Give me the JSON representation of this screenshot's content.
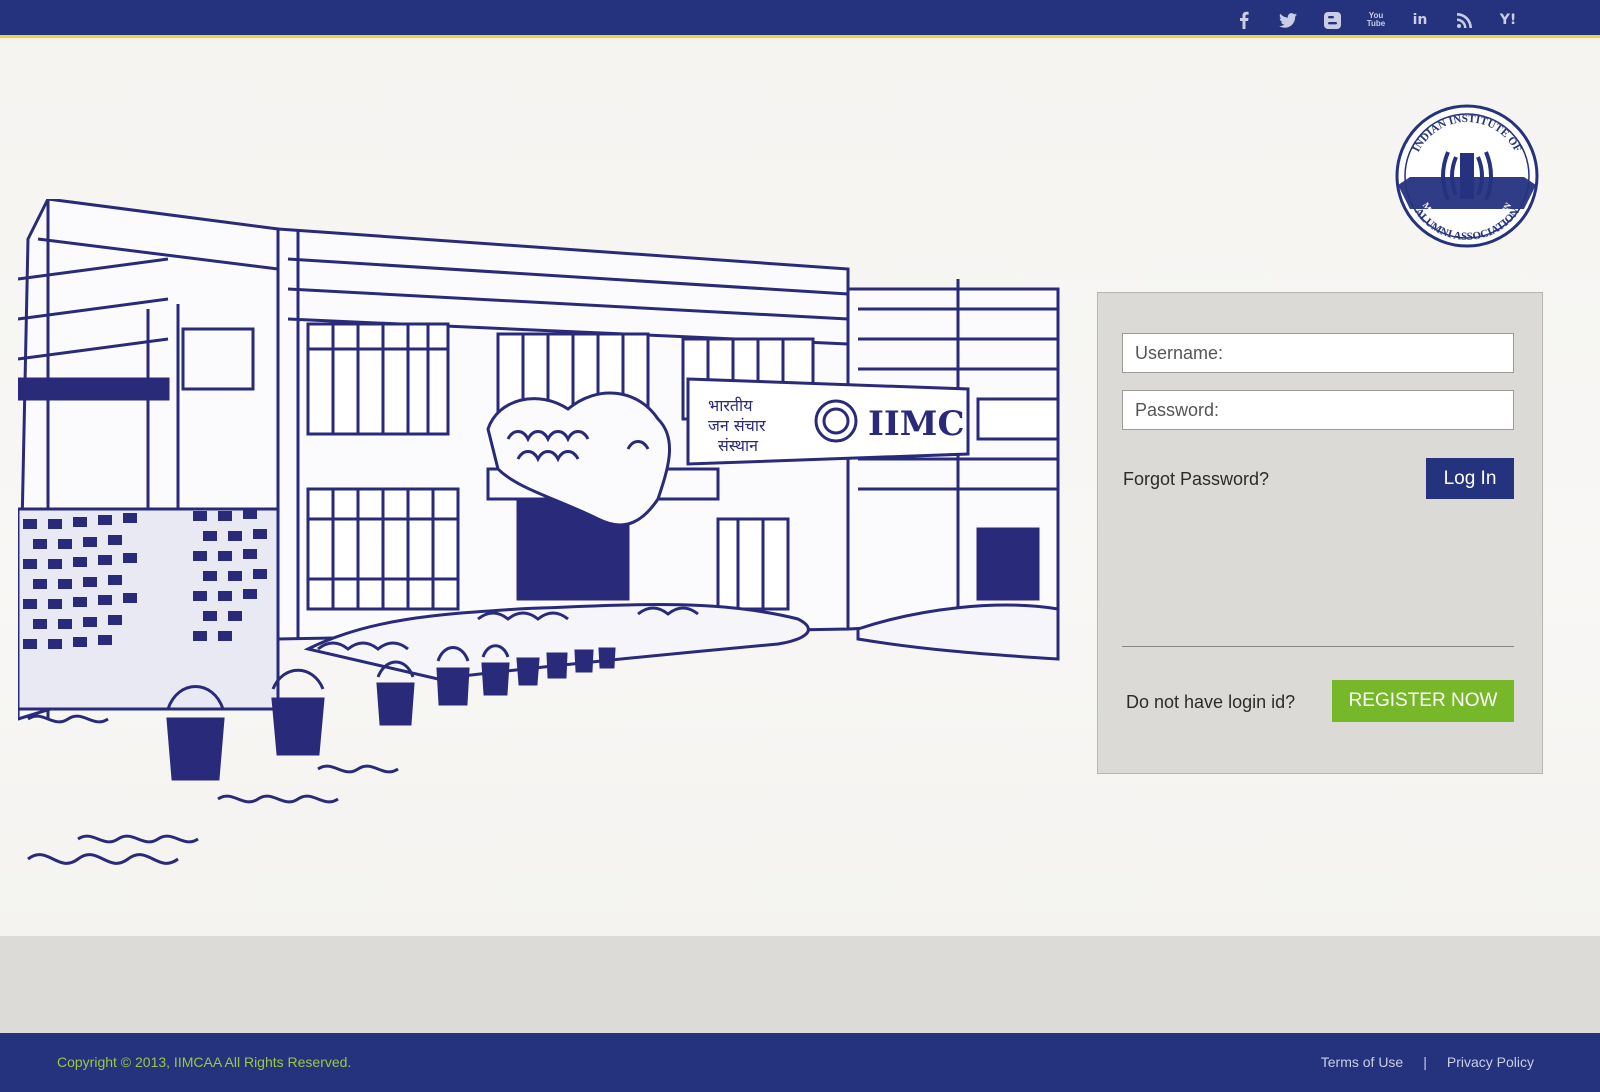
{
  "social": {
    "items": [
      {
        "name": "facebook-icon",
        "glyph": "f"
      },
      {
        "name": "twitter-icon",
        "glyph": "t"
      },
      {
        "name": "blogger-icon",
        "glyph": "B"
      },
      {
        "name": "youtube-icon",
        "glyph": "You Tube"
      },
      {
        "name": "linkedin-icon",
        "glyph": "in"
      },
      {
        "name": "rss-icon",
        "glyph": "rss"
      },
      {
        "name": "yahoo-icon",
        "glyph": "Y!"
      }
    ]
  },
  "sketch": {
    "sign_hindi_line1": "भारतीय",
    "sign_hindi_line2": "जन संचार",
    "sign_hindi_line3": "संस्थान",
    "sign_text": "IIMC"
  },
  "logo": {
    "top_text": "INDIAN INSTITUTE OF",
    "ribbon_text": "MASS COMMUNICATION",
    "bottom_text": "ALUMNI ASSOCIATION"
  },
  "login": {
    "username_placeholder": "Username:",
    "password_placeholder": "Password:",
    "forgot_label": "Forgot Password?",
    "login_label": "Log In",
    "no_id_label": "Do not have login id?",
    "register_label": "REGISTER NOW"
  },
  "footer": {
    "copyright": "Copyright © 2013, IIMCAA All Rights Reserved.",
    "terms": "Terms of Use",
    "separator": "|",
    "privacy": "Privacy Policy"
  },
  "colors": {
    "brand_blue": "#25337f",
    "accent_yellow": "#e3d93a",
    "register_green": "#77b82a",
    "copyright_green": "#9bc83e"
  }
}
